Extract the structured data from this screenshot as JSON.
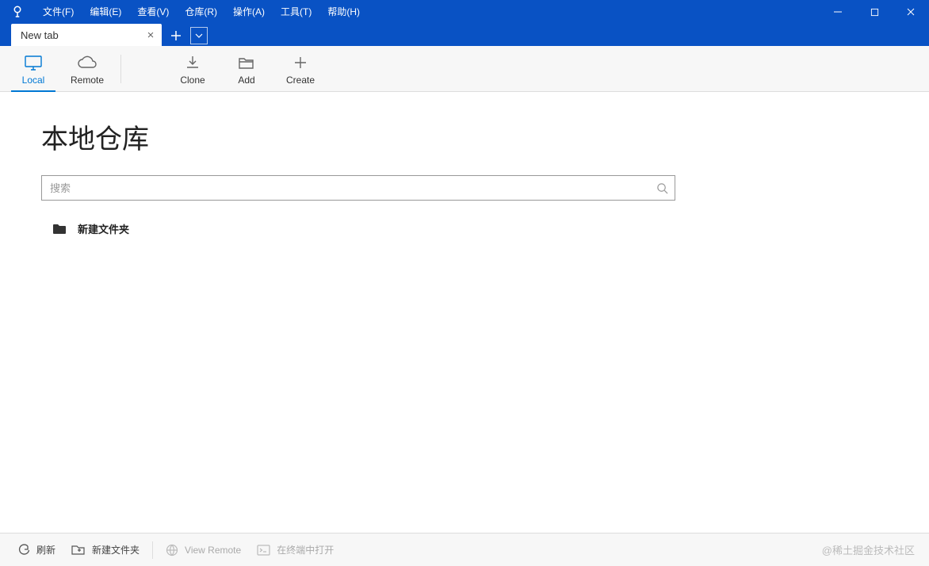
{
  "menubar": {
    "items": [
      {
        "label": "文件(F)",
        "key": "F"
      },
      {
        "label": "编辑(E)",
        "key": "E"
      },
      {
        "label": "查看(V)",
        "key": "V"
      },
      {
        "label": "仓库(R)",
        "key": "R"
      },
      {
        "label": "操作(A)",
        "key": "A"
      },
      {
        "label": "工具(T)",
        "key": "T"
      },
      {
        "label": "帮助(H)",
        "key": "H"
      }
    ]
  },
  "tabs": {
    "items": [
      {
        "title": "New tab"
      }
    ]
  },
  "toolbar": {
    "items": [
      {
        "id": "local",
        "label": "Local",
        "active": true
      },
      {
        "id": "remote",
        "label": "Remote",
        "active": false
      },
      {
        "id": "clone",
        "label": "Clone",
        "active": false
      },
      {
        "id": "add",
        "label": "Add",
        "active": false
      },
      {
        "id": "create",
        "label": "Create",
        "active": false
      }
    ]
  },
  "main": {
    "title": "本地仓库",
    "search_placeholder": "搜索",
    "repos": [
      {
        "name": "新建文件夹"
      }
    ]
  },
  "statusbar": {
    "refresh": "刷新",
    "new_folder": "新建文件夹",
    "view_remote": "View Remote",
    "open_terminal": "在终端中打开"
  },
  "watermark": "@稀土掘金技术社区"
}
